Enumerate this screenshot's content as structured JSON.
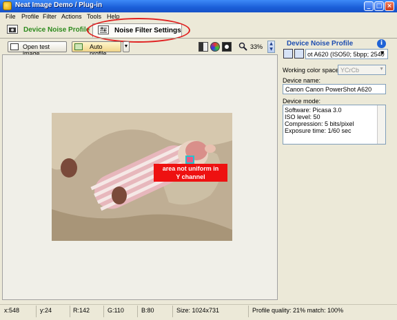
{
  "window": {
    "title": "Neat Image Demo / Plug-in"
  },
  "menu": [
    "File",
    "Profile",
    "Filter",
    "Actions",
    "Tools",
    "Help"
  ],
  "tabs": {
    "device_noise_profile": "Device Noise Profile",
    "noise_filter_settings": "Noise Filter Settings"
  },
  "toolbar": {
    "open_test_image": "Open test image",
    "auto_profile": "Auto profile",
    "zoom": "33%"
  },
  "image": {
    "warning_line1": "area not uniform in",
    "warning_line2": "Y channel"
  },
  "panel": {
    "title": "Device Noise Profile",
    "profile_select": "ot A620 (ISO50; 5bpp; 2540",
    "working_color_space_label": "Working color space:",
    "working_color_space_value": "YCrCb",
    "device_name_label": "Device name:",
    "device_name_value": "Canon Canon PowerShot A620",
    "device_mode_label": "Device mode:",
    "device_mode_lines": [
      "Software: Picasa 3.0",
      "ISO level: 50",
      "Compression: 5 bits/pixel",
      "Exposure time: 1/60 sec"
    ]
  },
  "status": {
    "x": "x:548",
    "y": "y:24",
    "r": "R:142",
    "g": "G:110",
    "b": "B:80",
    "size": "Size: 1024x731",
    "quality": "Profile quality: 21%  match: 100%"
  },
  "colors": {
    "titlebar": "#1b5fd8",
    "tab_green": "#2c8a1c",
    "panel_blue": "#1d4db0",
    "warning_red": "#ee1111",
    "highlight_ellipse": "#e02020"
  }
}
